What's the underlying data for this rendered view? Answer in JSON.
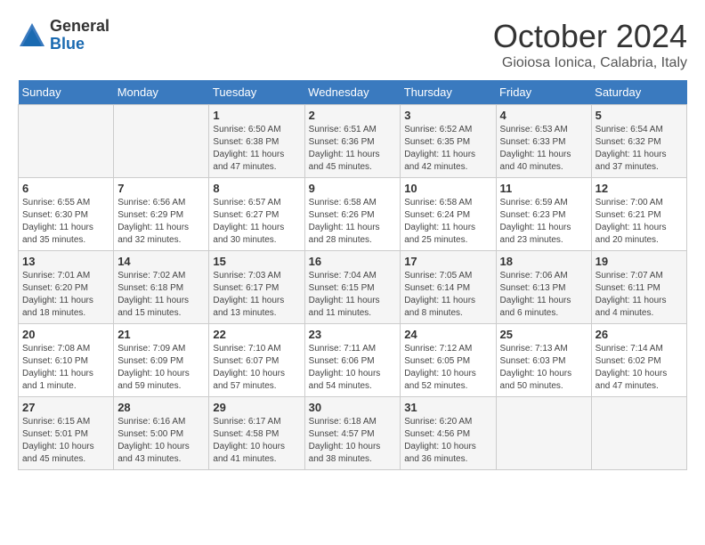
{
  "header": {
    "logo_general": "General",
    "logo_blue": "Blue",
    "month_title": "October 2024",
    "location": "Gioiosa Ionica, Calabria, Italy"
  },
  "days_of_week": [
    "Sunday",
    "Monday",
    "Tuesday",
    "Wednesday",
    "Thursday",
    "Friday",
    "Saturday"
  ],
  "weeks": [
    [
      {
        "day": "",
        "info": ""
      },
      {
        "day": "",
        "info": ""
      },
      {
        "day": "1",
        "info": "Sunrise: 6:50 AM\nSunset: 6:38 PM\nDaylight: 11 hours and 47 minutes."
      },
      {
        "day": "2",
        "info": "Sunrise: 6:51 AM\nSunset: 6:36 PM\nDaylight: 11 hours and 45 minutes."
      },
      {
        "day": "3",
        "info": "Sunrise: 6:52 AM\nSunset: 6:35 PM\nDaylight: 11 hours and 42 minutes."
      },
      {
        "day": "4",
        "info": "Sunrise: 6:53 AM\nSunset: 6:33 PM\nDaylight: 11 hours and 40 minutes."
      },
      {
        "day": "5",
        "info": "Sunrise: 6:54 AM\nSunset: 6:32 PM\nDaylight: 11 hours and 37 minutes."
      }
    ],
    [
      {
        "day": "6",
        "info": "Sunrise: 6:55 AM\nSunset: 6:30 PM\nDaylight: 11 hours and 35 minutes."
      },
      {
        "day": "7",
        "info": "Sunrise: 6:56 AM\nSunset: 6:29 PM\nDaylight: 11 hours and 32 minutes."
      },
      {
        "day": "8",
        "info": "Sunrise: 6:57 AM\nSunset: 6:27 PM\nDaylight: 11 hours and 30 minutes."
      },
      {
        "day": "9",
        "info": "Sunrise: 6:58 AM\nSunset: 6:26 PM\nDaylight: 11 hours and 28 minutes."
      },
      {
        "day": "10",
        "info": "Sunrise: 6:58 AM\nSunset: 6:24 PM\nDaylight: 11 hours and 25 minutes."
      },
      {
        "day": "11",
        "info": "Sunrise: 6:59 AM\nSunset: 6:23 PM\nDaylight: 11 hours and 23 minutes."
      },
      {
        "day": "12",
        "info": "Sunrise: 7:00 AM\nSunset: 6:21 PM\nDaylight: 11 hours and 20 minutes."
      }
    ],
    [
      {
        "day": "13",
        "info": "Sunrise: 7:01 AM\nSunset: 6:20 PM\nDaylight: 11 hours and 18 minutes."
      },
      {
        "day": "14",
        "info": "Sunrise: 7:02 AM\nSunset: 6:18 PM\nDaylight: 11 hours and 15 minutes."
      },
      {
        "day": "15",
        "info": "Sunrise: 7:03 AM\nSunset: 6:17 PM\nDaylight: 11 hours and 13 minutes."
      },
      {
        "day": "16",
        "info": "Sunrise: 7:04 AM\nSunset: 6:15 PM\nDaylight: 11 hours and 11 minutes."
      },
      {
        "day": "17",
        "info": "Sunrise: 7:05 AM\nSunset: 6:14 PM\nDaylight: 11 hours and 8 minutes."
      },
      {
        "day": "18",
        "info": "Sunrise: 7:06 AM\nSunset: 6:13 PM\nDaylight: 11 hours and 6 minutes."
      },
      {
        "day": "19",
        "info": "Sunrise: 7:07 AM\nSunset: 6:11 PM\nDaylight: 11 hours and 4 minutes."
      }
    ],
    [
      {
        "day": "20",
        "info": "Sunrise: 7:08 AM\nSunset: 6:10 PM\nDaylight: 11 hours and 1 minute."
      },
      {
        "day": "21",
        "info": "Sunrise: 7:09 AM\nSunset: 6:09 PM\nDaylight: 10 hours and 59 minutes."
      },
      {
        "day": "22",
        "info": "Sunrise: 7:10 AM\nSunset: 6:07 PM\nDaylight: 10 hours and 57 minutes."
      },
      {
        "day": "23",
        "info": "Sunrise: 7:11 AM\nSunset: 6:06 PM\nDaylight: 10 hours and 54 minutes."
      },
      {
        "day": "24",
        "info": "Sunrise: 7:12 AM\nSunset: 6:05 PM\nDaylight: 10 hours and 52 minutes."
      },
      {
        "day": "25",
        "info": "Sunrise: 7:13 AM\nSunset: 6:03 PM\nDaylight: 10 hours and 50 minutes."
      },
      {
        "day": "26",
        "info": "Sunrise: 7:14 AM\nSunset: 6:02 PM\nDaylight: 10 hours and 47 minutes."
      }
    ],
    [
      {
        "day": "27",
        "info": "Sunrise: 6:15 AM\nSunset: 5:01 PM\nDaylight: 10 hours and 45 minutes."
      },
      {
        "day": "28",
        "info": "Sunrise: 6:16 AM\nSunset: 5:00 PM\nDaylight: 10 hours and 43 minutes."
      },
      {
        "day": "29",
        "info": "Sunrise: 6:17 AM\nSunset: 4:58 PM\nDaylight: 10 hours and 41 minutes."
      },
      {
        "day": "30",
        "info": "Sunrise: 6:18 AM\nSunset: 4:57 PM\nDaylight: 10 hours and 38 minutes."
      },
      {
        "day": "31",
        "info": "Sunrise: 6:20 AM\nSunset: 4:56 PM\nDaylight: 10 hours and 36 minutes."
      },
      {
        "day": "",
        "info": ""
      },
      {
        "day": "",
        "info": ""
      }
    ]
  ]
}
